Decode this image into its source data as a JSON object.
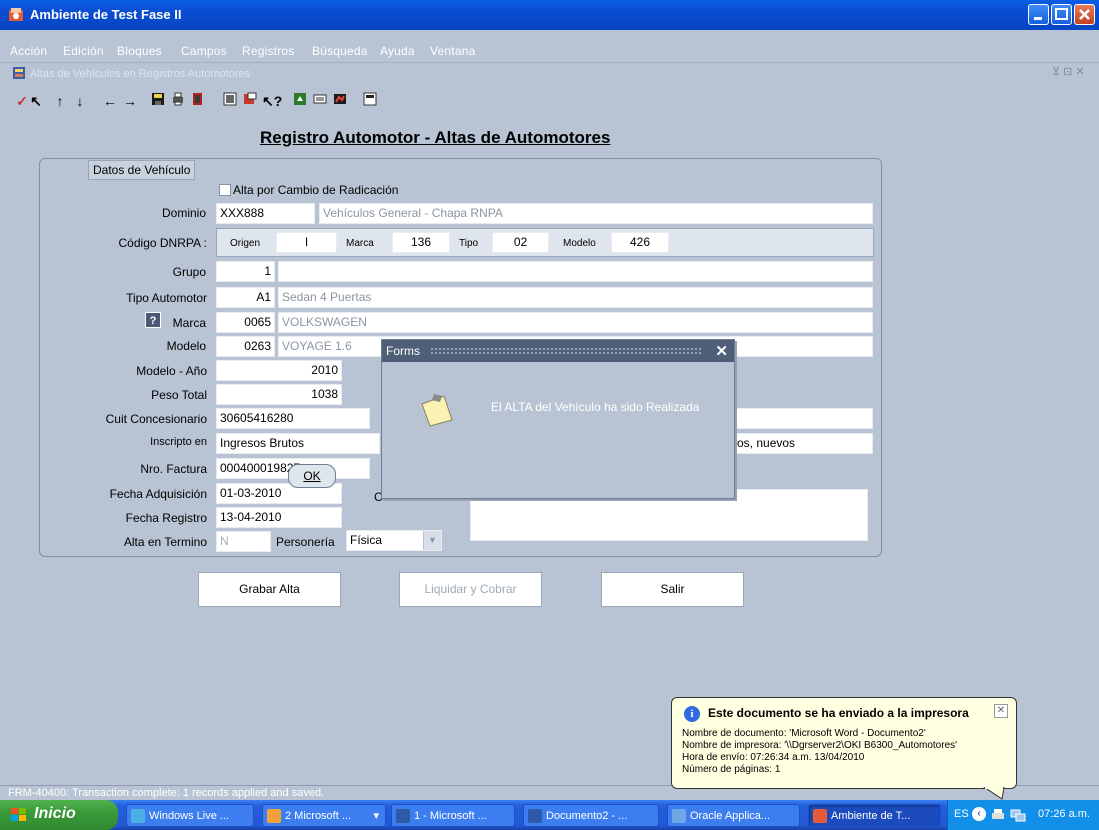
{
  "window": {
    "title": "Ambiente de Test Fase II"
  },
  "menu": [
    "Acción",
    "Edición",
    "Bloques",
    "Campos",
    "Registros",
    "Búsqueda",
    "Ayuda",
    "Ventana"
  ],
  "inner_window": {
    "title": "Altas de Vehículos en Registros Automotores"
  },
  "page_title": "Registro Automotor - Altas de Automotores",
  "form": {
    "section_label": "Datos de Vehículo",
    "checkbox_label": "Alta por Cambio de Radicación",
    "dominio_label": "Dominio",
    "dominio_value": "XXX888",
    "dominio_desc": "Vehículos General - Chapa RNPA",
    "codigo_label": "Código DNRPA :",
    "origen_label": "Origen",
    "origen_value": "I",
    "marca_code_label": "Marca",
    "marca_code_value": "136",
    "tipo_label": "Tipo",
    "tipo_value": "02",
    "modelo_code_label": "Modelo",
    "modelo_code_value": "426",
    "grupo_label": "Grupo",
    "grupo_value": "1",
    "tipo_auto_label": "Tipo Automotor",
    "tipo_auto_value": "A1",
    "tipo_auto_desc": "Sedan 4 Puertas",
    "marca_label": "Marca",
    "marca_value": "0065",
    "marca_desc": "VOLKSWAGEN",
    "help_icon_text": "?",
    "modelo_label": "Modelo",
    "modelo_value": "0263",
    "modelo_desc": "VOYAGE 1.6",
    "modelo_anio_label": "Modelo - Año",
    "modelo_anio_value": "2010",
    "peso_label": "Peso Total",
    "peso_value": "1038",
    "cuit_label": "Cuit Concesionario",
    "cuit_value": "30605416280",
    "inscripto_label": "Inscripto en",
    "inscripto_value": "Ingresos Brutos",
    "inscripto_right": "tilitarios, nuevos",
    "factura_label": "Nro. Factura",
    "factura_value": "000400019827",
    "fecha_adq_label": "Fecha Adquisición",
    "fecha_adq_value": "01-03-2010",
    "obs_label_partial": "C",
    "fecha_reg_label": "Fecha Registro",
    "fecha_reg_value": "13-04-2010",
    "alta_term_label": "Alta en Termino",
    "alta_term_value": "N",
    "personeria_label": "Personería",
    "personeria_value": "Física"
  },
  "dialog": {
    "title": "Forms",
    "message": "El ALTA del Vehículo ha sido Realizada",
    "ok_label": "OK"
  },
  "buttons": {
    "grabar": "Grabar Alta",
    "liquidar": "Liquidar y Cobrar",
    "salir": "Salir"
  },
  "status": "FRM-40400: Transaction complete: 1 records applied and saved.",
  "balloon": {
    "title": "Este documento se ha enviado a la impresora",
    "line1": "Nombre de documento: 'Microsoft Word - Documento2'",
    "line2": "Nombre de impresora: '\\\\Dgrserver2\\OKI B6300_Automotores'",
    "line3": "Hora de envío: 07:26:34 a.m.  13/04/2010",
    "line4": "Número de páginas: 1"
  },
  "taskbar": {
    "start": "Inicio",
    "tasks": [
      "Windows Live ...",
      "2 Microsoft ...",
      "1 - Microsoft ...",
      "Documento2 - ...",
      "Oracle Applica...",
      "Ambiente de T..."
    ],
    "lang": "ES",
    "clock": "07:26 a.m."
  },
  "colors": {
    "background": "#b8c4d4",
    "titlebar": "#0a5fe6",
    "taskbar": "#245edb",
    "start": "#3a9a3a"
  }
}
